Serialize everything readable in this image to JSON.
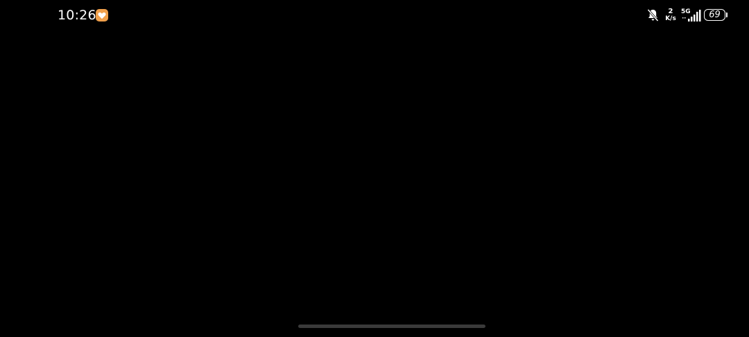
{
  "status_bar": {
    "time": "10:26",
    "app_notification_icon": "heart-app-icon",
    "app_notification_color": "#f0a04b",
    "mute_icon": "bell-off-icon",
    "net_speed_value": "2",
    "net_speed_unit": "K/s",
    "network_type": "5G",
    "signal_icon": "cellular-signal-icon",
    "signal_strength": 4,
    "battery_level": "69",
    "battery_icon": "battery-icon"
  },
  "colors": {
    "background": "#000000",
    "text": "#ffffff",
    "home_indicator": "#3a3a3a"
  }
}
